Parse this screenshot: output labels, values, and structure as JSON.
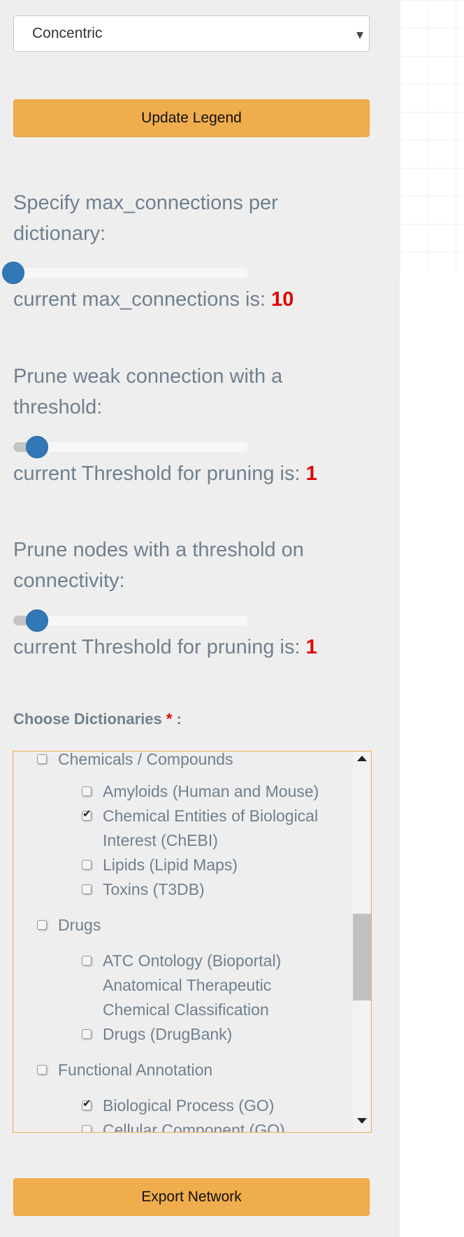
{
  "layout_select": {
    "value": "Concentric"
  },
  "update_legend_button": "Update Legend",
  "max_connections": {
    "label": "Specify max_connections per dictionary:",
    "current_prefix": "current max_connections is:",
    "value": "10",
    "slider_fraction": 0
  },
  "prune_weak": {
    "label": "Prune weak connection with a threshold:",
    "current_prefix": "current Threshold for pruning is:",
    "value": "1",
    "slider_fraction": 0.09
  },
  "prune_nodes": {
    "label": "Prune nodes with a threshold on connectivity:",
    "current_prefix": "current Threshold for pruning is:",
    "value": "1",
    "slider_fraction": 0.09
  },
  "dictionaries": {
    "label": "Choose Dictionaries",
    "required_marker": "*",
    "colon": ":",
    "groups": [
      {
        "name": "Chemicals / Compounds",
        "checked": false,
        "items": [
          {
            "name": "Amyloids (Human and Mouse)",
            "checked": false
          },
          {
            "name": "Chemical Entities of Biological Interest (ChEBI)",
            "checked": true
          },
          {
            "name": "Lipids (Lipid Maps)",
            "checked": false
          },
          {
            "name": "Toxins (T3DB)",
            "checked": false
          }
        ]
      },
      {
        "name": "Drugs",
        "checked": false,
        "items": [
          {
            "name": "ATC Ontology (Bioportal) Anatomical Therapeutic Chemical Classification",
            "checked": false
          },
          {
            "name": "Drugs (DrugBank)",
            "checked": false
          }
        ]
      },
      {
        "name": "Functional Annotation",
        "checked": false,
        "items": [
          {
            "name": "Biological Process (GO)",
            "checked": true
          },
          {
            "name": "Cellular Component (GO)",
            "checked": false
          }
        ]
      }
    ]
  },
  "export_button": "Export Network",
  "colors": {
    "accent": "#f0ad4e",
    "knob": "#3277b6",
    "value_red": "#e00000",
    "label_gray": "#708090"
  }
}
